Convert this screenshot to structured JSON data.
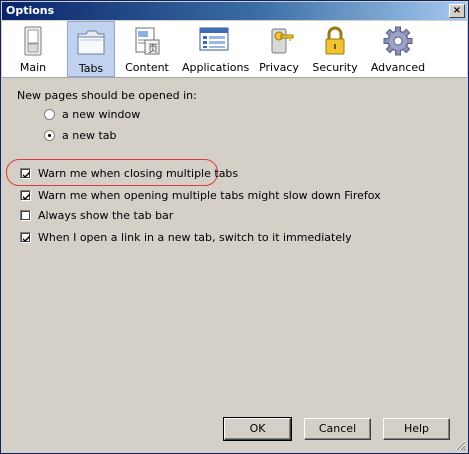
{
  "window": {
    "title": "Options",
    "close_glyph": "×"
  },
  "panes": [
    {
      "label": "Main",
      "icon": "switch-icon",
      "selected": false
    },
    {
      "label": "Tabs",
      "icon": "folder-tabs-icon",
      "selected": true
    },
    {
      "label": "Content",
      "icon": "content-document-icon",
      "selected": false
    },
    {
      "label": "Applications",
      "icon": "applications-window-icon",
      "selected": false
    },
    {
      "label": "Privacy",
      "icon": "privacy-key-icon",
      "selected": false
    },
    {
      "label": "Security",
      "icon": "padlock-icon",
      "selected": false
    },
    {
      "label": "Advanced",
      "icon": "gear-icon",
      "selected": false
    }
  ],
  "tabs_pane": {
    "new_pages_label": "New pages should be opened in:",
    "open_in": {
      "options": [
        "a new window",
        "a new tab"
      ],
      "selected": "a new tab"
    },
    "checkboxes": [
      {
        "label": "Warn me when closing multiple tabs",
        "checked": true,
        "highlighted": true
      },
      {
        "label": "Warn me when opening multiple tabs might slow down Firefox",
        "checked": true,
        "highlighted": false
      },
      {
        "label": "Always show the tab bar",
        "checked": false,
        "highlighted": false
      },
      {
        "label": "When I open a link in a new tab, switch to it immediately",
        "checked": true,
        "highlighted": false
      }
    ]
  },
  "buttons": {
    "ok": "OK",
    "cancel": "Cancel",
    "help": "Help"
  },
  "colors": {
    "title_bar_start": "#0a246a",
    "title_bar_end": "#a6caf0",
    "selected_pane": "#c1d2ee",
    "dialog_face": "#d4d0c8",
    "highlight_ring": "#e03a3a"
  }
}
